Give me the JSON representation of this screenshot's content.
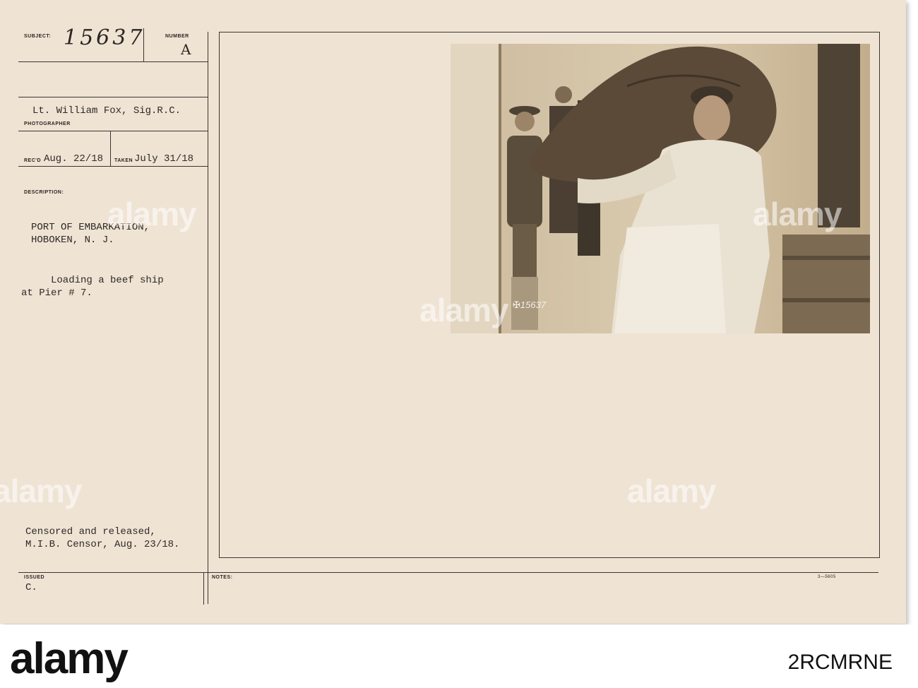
{
  "record": {
    "subject_label": "SUBJECT:",
    "subject_number": "15637",
    "number_label": "NUMBER",
    "number_value": "A",
    "photographer_name": "Lt. William Fox, Sig.R.C.",
    "photographer_label": "PHOTOGRAPHER",
    "recd_label": "REC'D",
    "recd_value": "Aug. 22/18",
    "taken_label": "TAKEN",
    "taken_value": "July 31/18",
    "description_label": "DESCRIPTION:",
    "desc_line_1": "PORT OF EMBARKATION,",
    "desc_line_2": "HOBOKEN, N. J.",
    "desc_line_3": "Loading a beef ship",
    "desc_line_4": "at Pier # 7.",
    "censor_line_1": "Censored and released,",
    "censor_line_2": "M.I.B. Censor, Aug. 23/18.",
    "issued_label": "ISSUED",
    "issued_value": "C.",
    "notes_label": "NOTES:",
    "form_code": "3—5605"
  },
  "photo": {
    "negative_mark": "15637"
  },
  "watermark": {
    "text": "alamy",
    "footer_logo": "alamy",
    "image_code": "2RCMRNE"
  },
  "colors": {
    "card": "#efe3d4",
    "ink": "#2d2926",
    "photo_sepia": "#bfad8f"
  }
}
